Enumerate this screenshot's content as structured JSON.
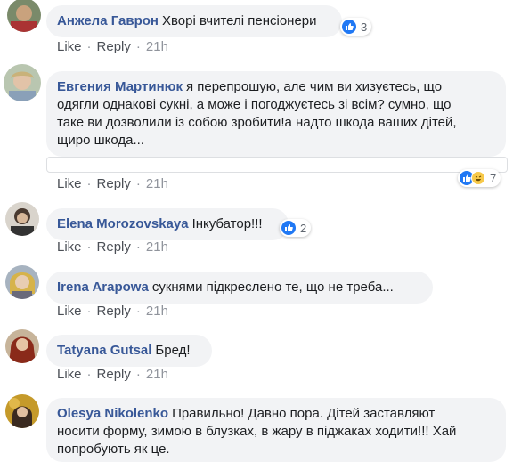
{
  "comments": [
    {
      "name": "Анжела Гаврон",
      "text": "Хворі вчителі пенсіонери",
      "reactions": "3"
    },
    {
      "name": "Евгения Мартинюк",
      "text_lines": [
        "я перепрошую, але чим ви хизуєтесь, що",
        "одягли однакові сукні, а може і погоджуєтесь зі всім? сумно, що",
        "таке ви дозволили із собою зробити!а надто шкода ваших дітей,",
        "щиро шкода..."
      ],
      "reactions": "7"
    },
    {
      "name": "Elena Morozovskaya",
      "text": "Інкубатор!!!",
      "reactions": "2"
    },
    {
      "name": "Irena Arapowa",
      "text": "сукнями підкреслено те, що не треба..."
    },
    {
      "name": "Tatyana Gutsal",
      "text": "Бред!"
    },
    {
      "name": "Olesya Nikolenko",
      "text_lines": [
        "Правильно! Давно пора. Дітей заставляют",
        "носити форму, зимою в блузках, в жару в піджаках ходити!!! Хай",
        "попробують як це."
      ]
    }
  ],
  "actions": {
    "like": "Like",
    "reply": "Reply",
    "time": "21h",
    "separator": "·"
  },
  "icons": {
    "like": "thumbs-up-icon",
    "haha": "laughing-face-icon"
  },
  "colors": {
    "name": "#385898",
    "bubble": "#f2f3f5",
    "like": "#2078f4"
  }
}
